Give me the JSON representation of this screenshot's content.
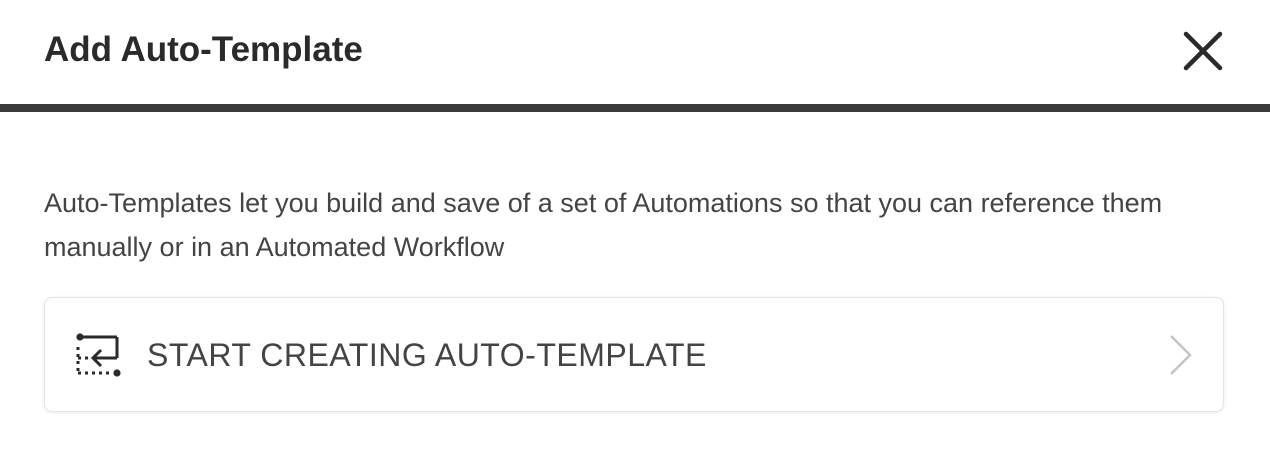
{
  "dialog": {
    "title": "Add Auto-Template",
    "close_icon": "close-icon",
    "description": "Auto-Templates let you build and save of a set of Automations so that you can reference them manually or in an Automated Workflow",
    "option": {
      "label": "START CREATING AUTO-TEMPLATE",
      "icon": "auto-template-icon",
      "trailing_icon": "chevron-right-icon"
    }
  },
  "colors": {
    "title": "#2a2a2a",
    "divider": "#3b3b3b",
    "text": "#444444",
    "card_border": "#e3e3e3",
    "chevron": "#c4c4c4"
  }
}
